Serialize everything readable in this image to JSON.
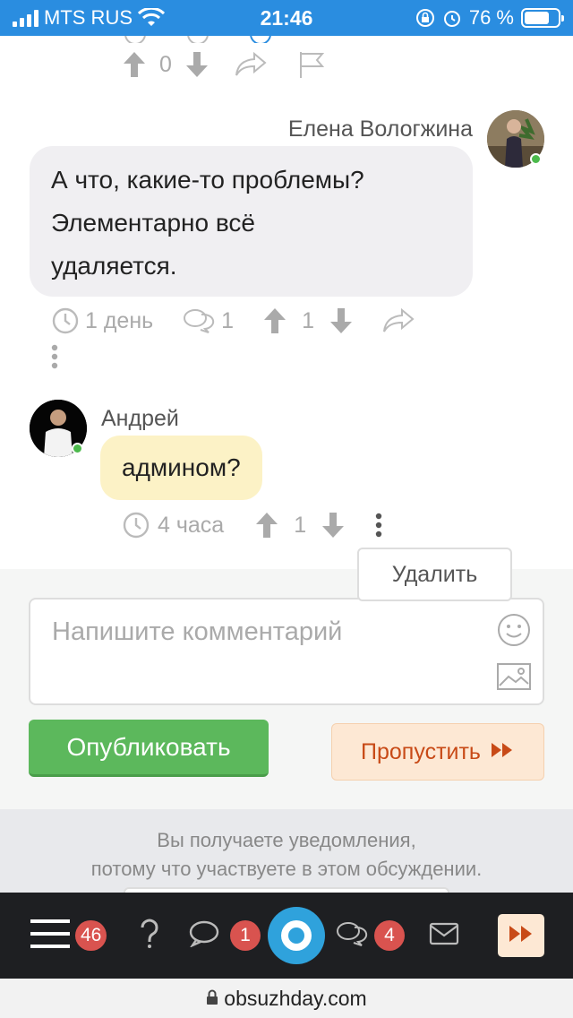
{
  "status_bar": {
    "carrier": "MTS RUS",
    "time": "21:46",
    "battery": "76 %"
  },
  "post_actions": {
    "vote_count": "0"
  },
  "comments": [
    {
      "author": "Елена Вологжина",
      "lines": [
        "А что, какие-то проблемы?",
        "Элементарно всё",
        "удаляется."
      ],
      "time": "1 день",
      "replies": "1",
      "votes": "1"
    },
    {
      "author": "Андрей",
      "text": "админом?",
      "time": "4 часа",
      "votes": "1"
    }
  ],
  "context_menu": {
    "delete_label": "Удалить"
  },
  "composer": {
    "placeholder": "Напишите комментарий",
    "publish_label": "Опубликовать",
    "skip_label": "Пропустить"
  },
  "notification": {
    "line1": "Вы получаете уведомления,",
    "line2": "потому что участвуете в этом обсуждении."
  },
  "bottom_nav": {
    "menu_badge": "46",
    "messages_badge": "1",
    "discussions_badge": "4"
  },
  "browser": {
    "url": "obsuzhday.com"
  },
  "colors": {
    "accent": "#2fa2dc",
    "publish": "#5cb85c",
    "skip_text": "#c84a17",
    "badge": "#d9534f"
  }
}
